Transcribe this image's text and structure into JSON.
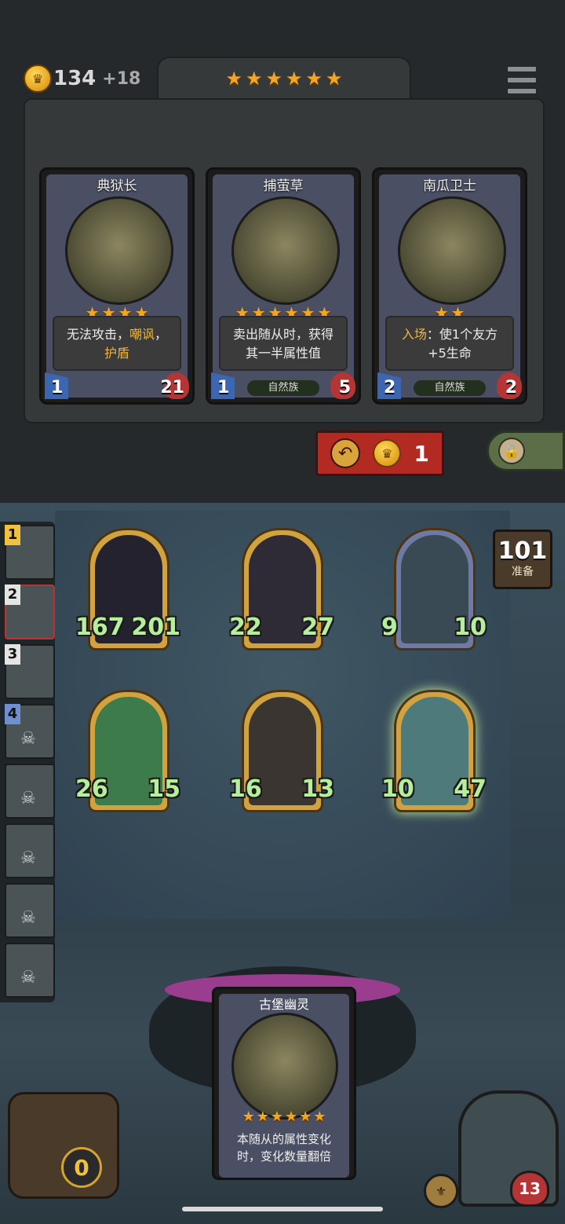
{
  "header": {
    "gold": "134",
    "gold_income": "+18",
    "tier_stars": 6,
    "menu_icon": "menu-icon"
  },
  "shop": {
    "cards": [
      {
        "name": "典狱长",
        "stars": 4,
        "desc_parts": [
          "无法攻击，",
          "嘲讽",
          "，",
          "护盾"
        ],
        "attack": "1",
        "health": "21",
        "tribe": ""
      },
      {
        "name": "捕萤草",
        "stars": 6,
        "desc_line1": "卖出随从时，获得",
        "desc_line2": "其一半属性值",
        "attack": "1",
        "health": "5",
        "tribe": "自然族"
      },
      {
        "name": "南瓜卫士",
        "stars": 2,
        "desc_hl": "入场",
        "desc_rest": "：使1个友方",
        "desc_line2": "+5生命",
        "attack": "2",
        "health": "2",
        "tribe": "自然族"
      }
    ],
    "refresh_cost": "1"
  },
  "board": {
    "prep_count": "101",
    "prep_label": "准备",
    "minions": [
      {
        "attack": "167",
        "health": "201"
      },
      {
        "attack": "22",
        "health": "27"
      },
      {
        "attack": "9",
        "health": "10"
      },
      {
        "attack": "26",
        "health": "15"
      },
      {
        "attack": "16",
        "health": "13"
      },
      {
        "attack": "10",
        "health": "47"
      }
    ]
  },
  "players": [
    {
      "rank": "1"
    },
    {
      "rank": "2"
    },
    {
      "rank": "3"
    },
    {
      "rank": "4"
    },
    {
      "rank": ""
    },
    {
      "rank": ""
    },
    {
      "rank": ""
    },
    {
      "rank": ""
    }
  ],
  "hand": {
    "name": "古堡幽灵",
    "stars": 6,
    "desc_line1": "本随从的属性变化",
    "desc_line2": "时，变化数量翻倍"
  },
  "bottom": {
    "bag_count": "0",
    "hero_health": "13"
  },
  "colors": {
    "gold": "#f3a623",
    "stat_green": "#b6ef9c",
    "refresh_red": "#b32a22",
    "highlight": "#f0b53a"
  }
}
